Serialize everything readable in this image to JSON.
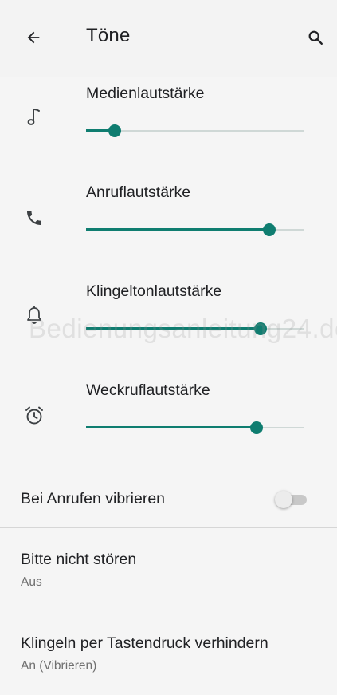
{
  "app_bar": {
    "title": "Töne",
    "back_icon": "arrow-back-icon",
    "search_icon": "search-icon"
  },
  "colors": {
    "accent": "#0f7d70",
    "track": "#cfd8d6",
    "background": "#f5f5f5",
    "secondary_text": "#6f6f6f"
  },
  "volume_sliders": [
    {
      "label": "Medienlautstärke",
      "icon": "music-note-icon",
      "level": 0.13
    },
    {
      "label": "Anruflautstärke",
      "icon": "phone-icon",
      "level": 0.84
    },
    {
      "label": "Klingeltonlautstärke",
      "icon": "bell-icon",
      "level": 0.8
    },
    {
      "label": "Weckruflautstärke",
      "icon": "alarm-clock-icon",
      "level": 0.78
    }
  ],
  "watermark": "Bedienungsanleitung24.de",
  "vibrate_on_call": {
    "label": "Bei Anrufen vibrieren",
    "enabled": false
  },
  "settings": [
    {
      "title": "Bitte nicht stören",
      "subtitle": "Aus"
    },
    {
      "title": "Klingeln per Tastendruck verhindern",
      "subtitle": "An (Vibrieren)"
    }
  ]
}
